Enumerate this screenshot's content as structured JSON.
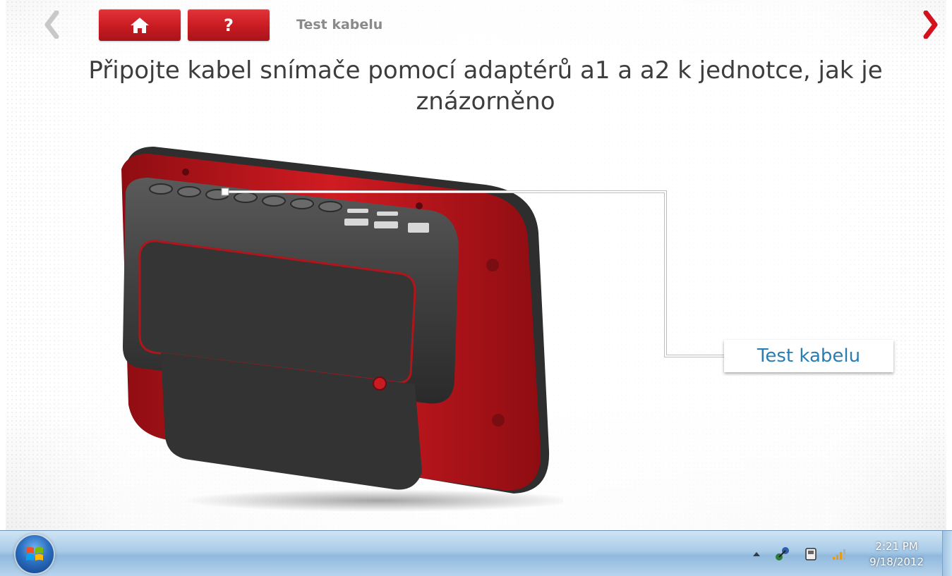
{
  "header": {
    "back_icon": "chevron-left-icon",
    "next_icon": "chevron-right-icon",
    "home_icon": "home-icon",
    "help_label": "?",
    "breadcrumb": "Test kabelu"
  },
  "main": {
    "instruction": "Připojte kabel snímače pomocí adaptérů a1 a a2 k jednotce, jak je znázorněno",
    "callout_label": "Test kabelu",
    "device_image": "tachograph-programmer-device"
  },
  "taskbar": {
    "start_icon": "windows-start-orb",
    "tray_icons": [
      "show-hidden-icons-arrow",
      "network-usb-icon",
      "device-icon",
      "signal-icon"
    ],
    "time": "2:21 PM",
    "date": "9/18/2012"
  },
  "colors": {
    "accent_red": "#c81b22",
    "callout_blue": "#2a7db3",
    "text_dark": "#3d3d3d"
  }
}
